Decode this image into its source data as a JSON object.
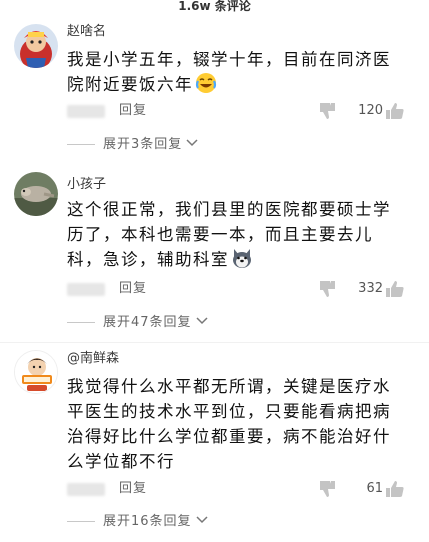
{
  "header": {
    "title": "1.6w 条评论"
  },
  "comments": [
    {
      "username": "赵啥名",
      "lines": [
        "我是小学五年，辍学十年，目前在同济医",
        "院附近要饭六年"
      ],
      "emoji": "crying-laughing-emoji",
      "reply_label": "回复",
      "likes": "120",
      "expand_label": "展开3条回复"
    },
    {
      "username": "小孩子",
      "lines": [
        "这个很正常，我们县里的医院都要硕士学",
        "历了，本科也需要一本，而且主要去儿",
        "科，急诊，辅助科室"
      ],
      "emoji": "husky-dog-emoji",
      "reply_label": "回复",
      "likes": "332",
      "expand_label": "展开47条回复"
    },
    {
      "username": "@南鲜森",
      "lines": [
        "我觉得什么水平都无所谓，关键是医疗水",
        "平医生的技术水平到位，只要能看病把病",
        "治得好比什么学位都重要，病不能治好什",
        "么学位都不行"
      ],
      "reply_label": "回复",
      "likes": "61",
      "expand_label": "展开16条回复"
    }
  ],
  "colors": {
    "text": "#111111",
    "meta": "#666666",
    "divider": "#f1f1f1"
  }
}
